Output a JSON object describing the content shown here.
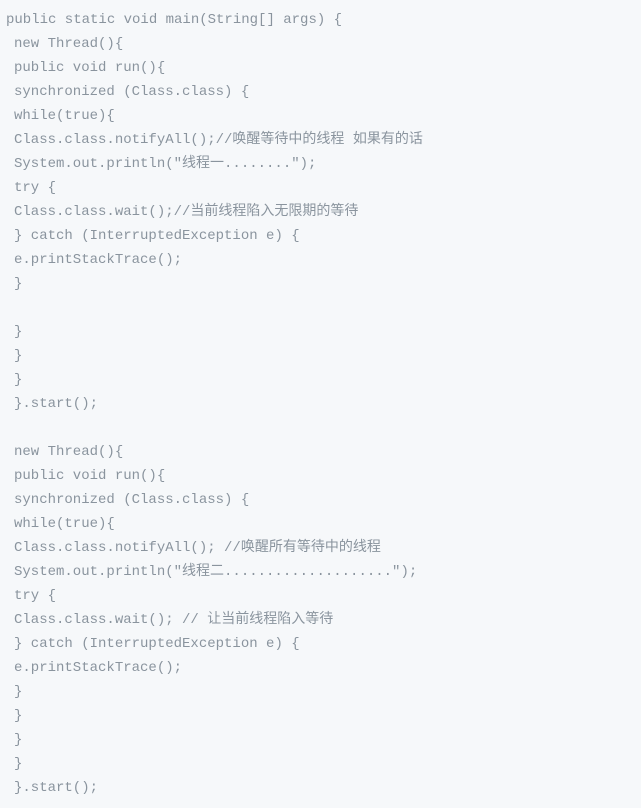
{
  "code_lines": [
    {
      "text": "public static void main(String[] args) {",
      "indent": 0
    },
    {
      "text": "new Thread(){",
      "indent": 1
    },
    {
      "text": "public void run(){",
      "indent": 1
    },
    {
      "text": "synchronized (Class.class) {",
      "indent": 1
    },
    {
      "text": "while(true){",
      "indent": 1
    },
    {
      "text": "Class.class.notifyAll();//唤醒等待中的线程 如果有的话",
      "indent": 1
    },
    {
      "text": "System.out.println(\"线程一........\");",
      "indent": 1
    },
    {
      "text": "try {",
      "indent": 1
    },
    {
      "text": "Class.class.wait();//当前线程陷入无限期的等待",
      "indent": 1
    },
    {
      "text": "} catch (InterruptedException e) {",
      "indent": 1
    },
    {
      "text": "e.printStackTrace();",
      "indent": 1
    },
    {
      "text": "}",
      "indent": 1
    },
    {
      "text": "",
      "indent": 1
    },
    {
      "text": "}",
      "indent": 1
    },
    {
      "text": "}",
      "indent": 1
    },
    {
      "text": "}",
      "indent": 1
    },
    {
      "text": "}.start();",
      "indent": 1
    },
    {
      "text": "",
      "indent": 1
    },
    {
      "text": "new Thread(){",
      "indent": 1
    },
    {
      "text": "public void run(){",
      "indent": 1
    },
    {
      "text": "synchronized (Class.class) {",
      "indent": 1
    },
    {
      "text": "while(true){",
      "indent": 1
    },
    {
      "text": "Class.class.notifyAll(); //唤醒所有等待中的线程",
      "indent": 1
    },
    {
      "text": "System.out.println(\"线程二....................\");",
      "indent": 1
    },
    {
      "text": "try {",
      "indent": 1
    },
    {
      "text": "Class.class.wait(); // 让当前线程陷入等待",
      "indent": 1
    },
    {
      "text": "} catch (InterruptedException e) {",
      "indent": 1
    },
    {
      "text": "e.printStackTrace();",
      "indent": 1
    },
    {
      "text": "}",
      "indent": 1
    },
    {
      "text": "}",
      "indent": 1
    },
    {
      "text": "}",
      "indent": 1
    },
    {
      "text": "}",
      "indent": 1
    },
    {
      "text": "}.start();",
      "indent": 1
    }
  ]
}
